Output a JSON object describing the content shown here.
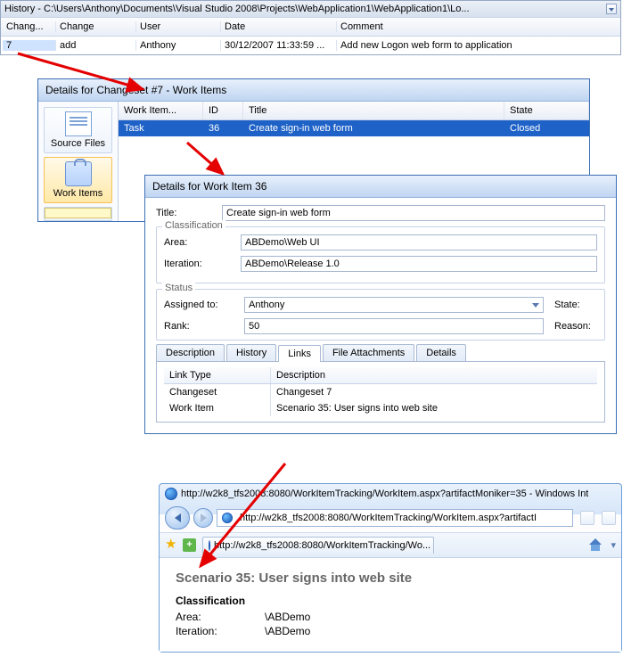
{
  "history": {
    "title": "History - C:\\Users\\Anthony\\Documents\\Visual Studio 2008\\Projects\\WebApplication1\\WebApplication1\\Lo...",
    "columns": {
      "changeset": "Chang...",
      "change": "Change",
      "user": "User",
      "date": "Date",
      "comment": "Comment"
    },
    "row": {
      "changeset": "7",
      "change": "add",
      "user": "Anthony",
      "date": "30/12/2007 11:33:59 ...",
      "comment": "Add new Logon web form to application"
    }
  },
  "changeset": {
    "title": "Details for Changeset #7 - Work Items",
    "nav": {
      "source": "Source Files",
      "work": "Work Items"
    },
    "cols": {
      "type": "Work Item...",
      "id": "ID",
      "title": "Title",
      "state": "State"
    },
    "row": {
      "type": "Task",
      "id": "36",
      "title": "Create sign-in web form",
      "state": "Closed"
    }
  },
  "workitem": {
    "title": "Details for Work Item 36",
    "labels": {
      "title": "Title:",
      "classification": "Classification",
      "area": "Area:",
      "iteration": "Iteration:",
      "status": "Status",
      "assigned": "Assigned to:",
      "state": "State:",
      "rank": "Rank:",
      "reason": "Reason:"
    },
    "values": {
      "title": "Create sign-in web form",
      "area": "ABDemo\\Web UI",
      "iteration": "ABDemo\\Release 1.0",
      "assigned": "Anthony",
      "rank": "50"
    },
    "tabs": {
      "description": "Description",
      "history": "History",
      "links": "Links",
      "attachments": "File Attachments",
      "details": "Details"
    },
    "links": {
      "cols": {
        "type": "Link Type",
        "desc": "Description"
      },
      "rows": [
        {
          "type": "Changeset",
          "desc": "Changeset 7"
        },
        {
          "type": "Work Item",
          "desc": "Scenario 35: User signs into web site"
        }
      ]
    }
  },
  "browser": {
    "windowTitle": "http://w2k8_tfs2008:8080/WorkItemTracking/WorkItem.aspx?artifactMoniker=35 - Windows Int",
    "url": "http://w2k8_tfs2008:8080/WorkItemTracking/WorkItem.aspx?artifactI",
    "tabTitle": "http://w2k8_tfs2008:8080/WorkItemTracking/Wo...",
    "page": {
      "heading": "Scenario 35: User signs into web site",
      "section": "Classification",
      "areaLabel": "Area:",
      "areaValue": "\\ABDemo",
      "iterLabel": "Iteration:",
      "iterValue": "\\ABDemo"
    }
  }
}
